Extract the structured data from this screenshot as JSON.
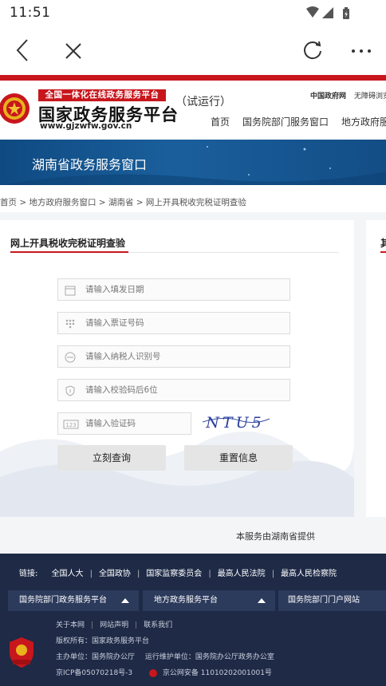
{
  "status_bar": {
    "time": "11:51"
  },
  "browser": {
    "back": "back",
    "close": "close",
    "reload": "reload",
    "more": "more"
  },
  "header": {
    "banner": "全国一体化在线政务服务平台",
    "brand": "国家政务服务平台",
    "url": "www.gjzwfw.gov.cn",
    "trial": "（试运行）",
    "gov_site": "中国政府网",
    "accessibility": "无障碍浏览",
    "nav": [
      "首页",
      "国务院部门服务窗口",
      "地方政府服务窗口"
    ]
  },
  "region": {
    "title": "湖南省政务服务窗口"
  },
  "breadcrumb": "首页 > 地方政府服务窗口 > 湖南省 > 网上开具税收完税证明查验",
  "form": {
    "title": "网上开具税收完税证明查验",
    "fields": [
      {
        "placeholder": "请输入填发日期",
        "icon": "calendar-icon"
      },
      {
        "placeholder": "请输入票证号码",
        "icon": "keypad-icon"
      },
      {
        "placeholder": "请输入纳税人识别号",
        "icon": "id-icon"
      },
      {
        "placeholder": "请输入校验码后6位",
        "icon": "shield-icon"
      },
      {
        "placeholder": "请输入验证码",
        "icon": "captcha-icon"
      }
    ],
    "captcha_text": "NTU5",
    "query_button": "立刻查询",
    "reset_button": "重置信息"
  },
  "right_card": {
    "title": "其"
  },
  "provider": "本服务由湖南省提供",
  "footer": {
    "links_label": "链接:",
    "links": [
      "全国人大",
      "全国政协",
      "国家监察委员会",
      "最高人民法院",
      "最高人民检察院"
    ],
    "dropdowns": [
      "国务院部门政务服务平台",
      "地方政务服务平台",
      "国务院部门门户网站"
    ],
    "bottom_links": [
      "关于本网",
      "网站声明",
      "联系我们"
    ],
    "copyright": "版权所有：国家政务服务平台",
    "organizer": "主办单位：国务院办公厅",
    "maintainer": "运行维护单位：国务院办公厅政务办公室",
    "icp": "京ICP备05070218号-3",
    "police": "京公网安备 11010202001001号",
    "badge": "党政机关"
  },
  "colors": {
    "accent_red": "#c8161d",
    "region_blue": "#134d86",
    "footer_bg": "#1e2a46"
  }
}
